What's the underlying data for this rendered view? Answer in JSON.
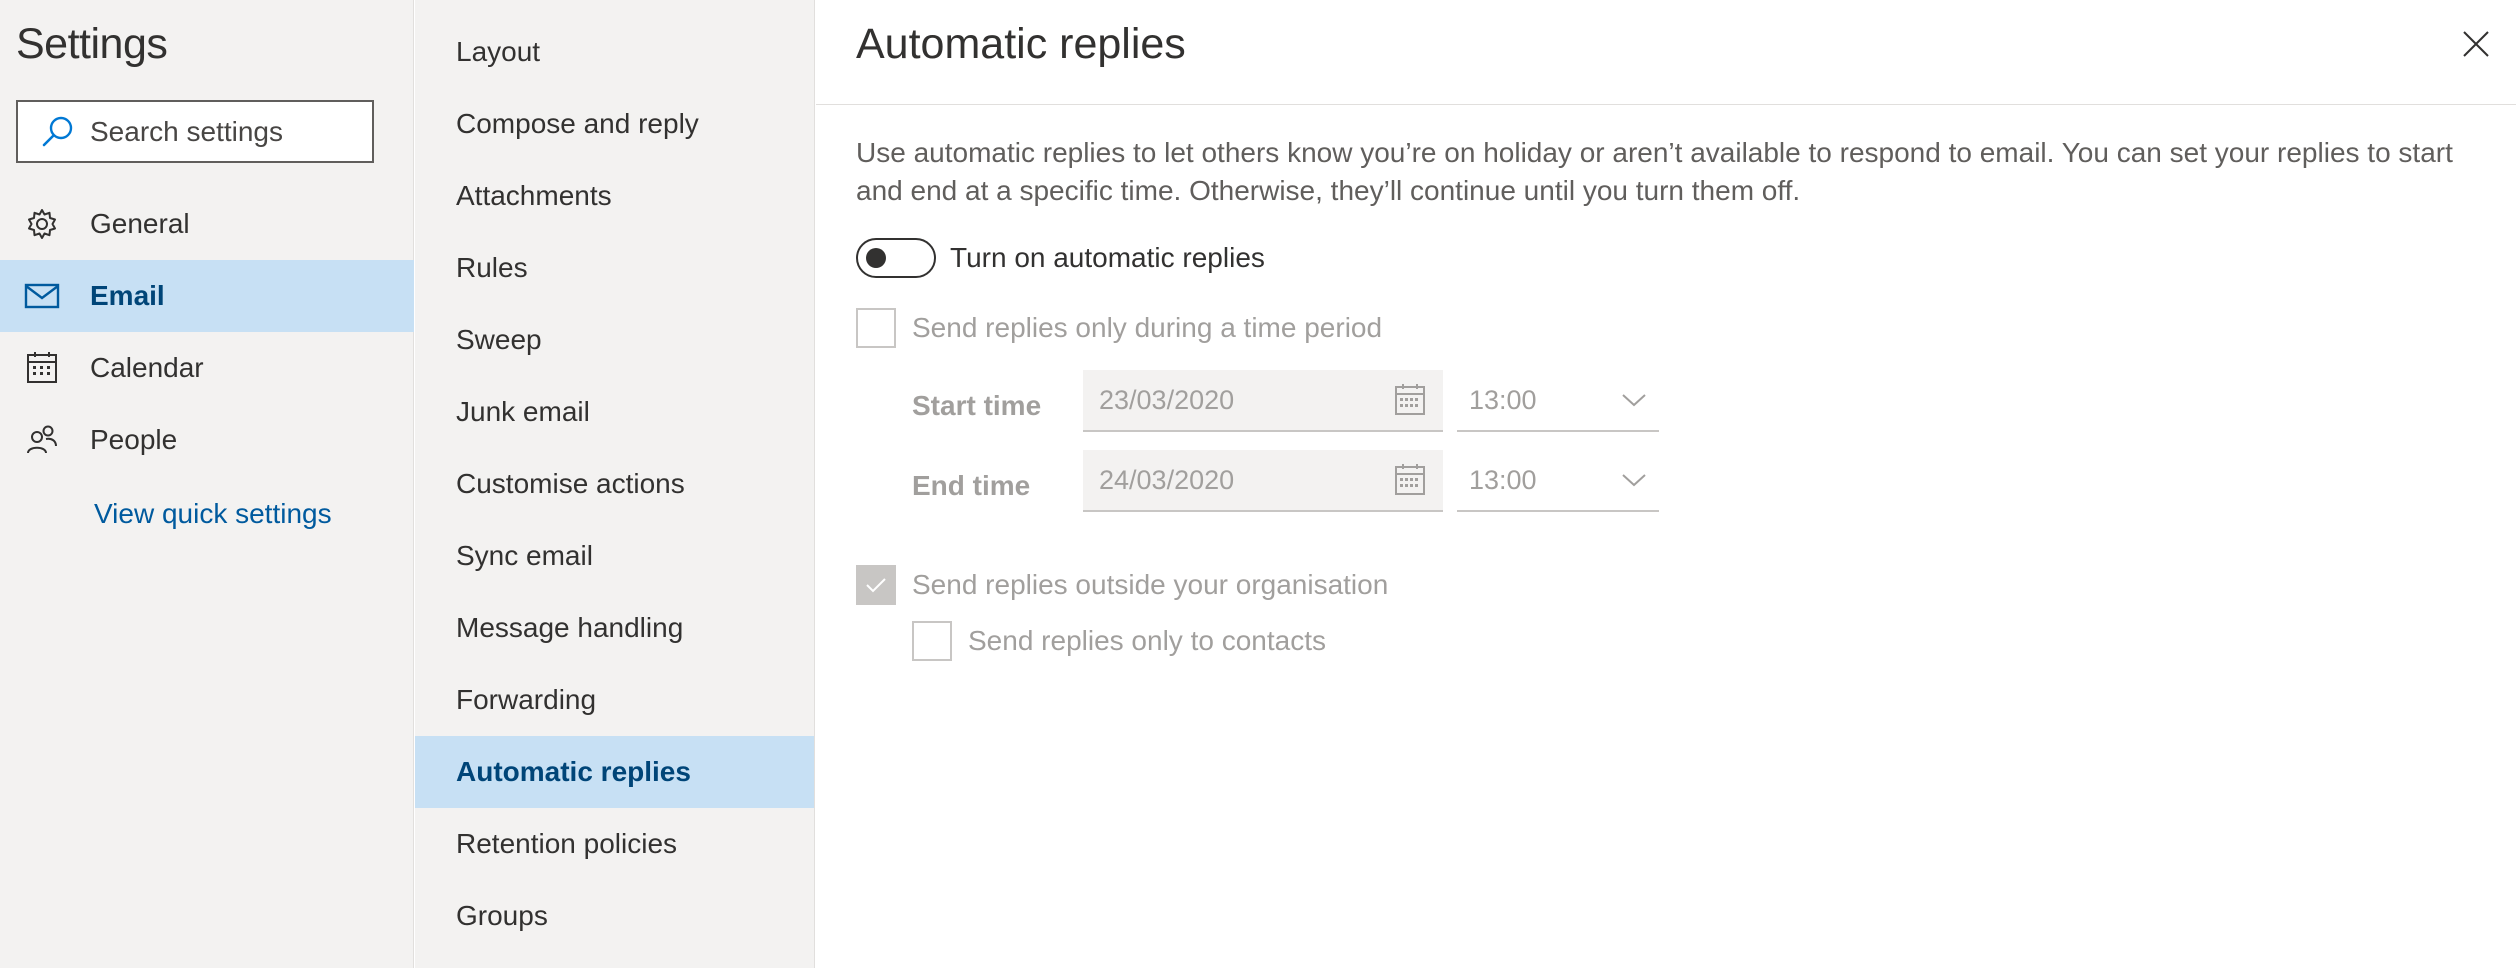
{
  "nav": {
    "title": "Settings",
    "search_placeholder": "Search settings",
    "items": [
      {
        "label": "General",
        "icon": "gear-icon"
      },
      {
        "label": "Email",
        "icon": "mail-icon",
        "selected": true
      },
      {
        "label": "Calendar",
        "icon": "calendar-icon"
      },
      {
        "label": "People",
        "icon": "people-icon"
      }
    ],
    "quick_link": "View quick settings"
  },
  "subnav": {
    "items": [
      {
        "label": "Layout"
      },
      {
        "label": "Compose and reply"
      },
      {
        "label": "Attachments"
      },
      {
        "label": "Rules"
      },
      {
        "label": "Sweep"
      },
      {
        "label": "Junk email"
      },
      {
        "label": "Customise actions"
      },
      {
        "label": "Sync email"
      },
      {
        "label": "Message handling"
      },
      {
        "label": "Forwarding"
      },
      {
        "label": "Automatic replies",
        "selected": true
      },
      {
        "label": "Retention policies"
      },
      {
        "label": "Groups"
      }
    ]
  },
  "panel": {
    "title": "Automatic replies",
    "description": "Use automatic replies to let others know you’re on holiday or aren’t available to respond to email. You can set your replies to start and end at a specific time. Otherwise, they’ll continue until you turn them off.",
    "toggle_label": "Turn on automatic replies",
    "toggle_on": false,
    "time_period_label": "Send replies only during a time period",
    "time_period_checked": false,
    "start": {
      "label": "Start time",
      "date": "23/03/2020",
      "time": "13:00"
    },
    "end": {
      "label": "End time",
      "date": "24/03/2020",
      "time": "13:00"
    },
    "outside_org_label": "Send replies outside your organisation",
    "outside_org_checked": true,
    "contacts_only_label": "Send replies only to contacts",
    "contacts_only_checked": false
  },
  "colors": {
    "accent": "#005a9e",
    "selected_bg": "#c7e0f4",
    "nav_bg": "#f3f2f1",
    "disabled_text": "#a19f9d"
  }
}
